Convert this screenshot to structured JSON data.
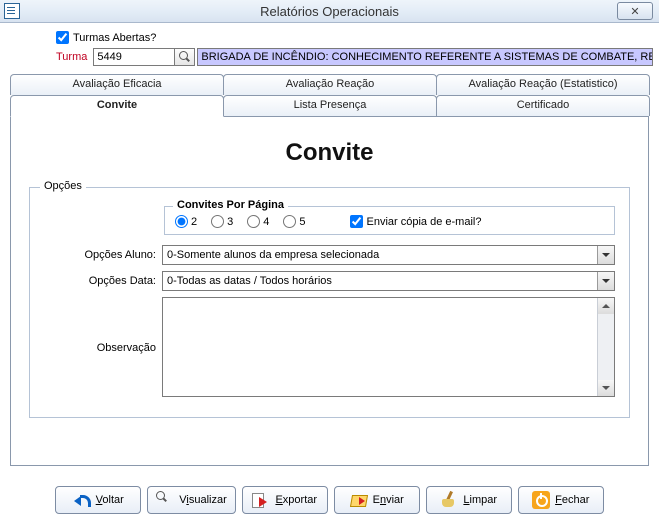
{
  "window": {
    "title": "Relatórios Operacionais",
    "close_hint": "✕"
  },
  "top": {
    "turmas_abertas_label": "Turmas Abertas?",
    "turmas_abertas_checked": true,
    "turma_label": "Turma",
    "turma_value": "5449",
    "turma_desc": "BRIGADA DE INCÊNDIO: CONHECIMENTO REFERENTE A SISTEMAS DE COMBATE, RECURS"
  },
  "tabs": {
    "row1": [
      "Avaliação Eficacia",
      "Avaliação Reação",
      "Avaliação Reação (Estatistico)"
    ],
    "row2": [
      "Convite",
      "Lista Presença",
      "Certificado"
    ],
    "active": "Convite"
  },
  "panel": {
    "title": "Convite",
    "group_label": "Opções",
    "per_page_label": "Convites Por Página",
    "per_page_options": [
      "2",
      "3",
      "4",
      "5"
    ],
    "per_page_selected": "2",
    "email_copy_label": "Enviar cópia de e-mail?",
    "email_copy_checked": true,
    "aluno_label": "Opções Aluno:",
    "aluno_value": "0-Somente alunos da empresa selecionada",
    "data_label": "Opções Data:",
    "data_value": "0-Todas as datas / Todos horários",
    "obs_label": "Observação",
    "obs_value": ""
  },
  "buttons": {
    "voltar": "Voltar",
    "visualizar": "Visualizar",
    "exportar": "Exportar",
    "enviar": "Enviar",
    "limpar": "Limpar",
    "fechar": "Fechar"
  }
}
